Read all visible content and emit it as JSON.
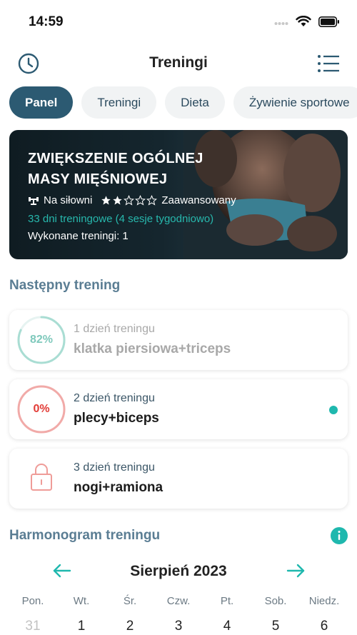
{
  "status": {
    "time": "14:59"
  },
  "nav": {
    "title": "Treningi"
  },
  "tabs": [
    {
      "label": "Panel"
    },
    {
      "label": "Treningi"
    },
    {
      "label": "Dieta"
    },
    {
      "label": "Żywienie sportowe"
    }
  ],
  "hero": {
    "title_line1": "ZWIĘKSZENIE OGÓLNEJ",
    "title_line2": "MASY MIĘŚNIOWEJ",
    "location": "Na siłowni",
    "level": "Zaawansowany",
    "rating": 2,
    "rating_max": 5,
    "days": "33 dni treningowe (4 sesje tygodniowo)",
    "done": "Wykonane treningi: 1"
  },
  "next_training": {
    "title": "Następny trening",
    "cards": [
      {
        "percent": "82%",
        "progress": 0.82,
        "day": "1 dzień treningu",
        "name": "klatka piersiowa+triceps",
        "state": "faded"
      },
      {
        "percent": "0%",
        "progress": 0,
        "day": "2 dzień treningu",
        "name": "plecy+biceps",
        "state": "active"
      },
      {
        "percent": "",
        "day": "3 dzień treningu",
        "name": "nogi+ramiona",
        "state": "locked"
      }
    ]
  },
  "schedule": {
    "title": "Harmonogram treningu",
    "month": "Sierpień 2023",
    "weekdays": [
      "Pon.",
      "Wt.",
      "Śr.",
      "Czw.",
      "Pt.",
      "Sob.",
      "Niedz."
    ],
    "days": [
      "31",
      "1",
      "2",
      "3",
      "4",
      "5",
      "6"
    ]
  },
  "colors": {
    "accent": "#2c5a72",
    "teal": "#1fb8ae",
    "ring_done": "#a9ddd3",
    "ring_zero": "#f1aaa8",
    "lock": "#ef9c98"
  }
}
